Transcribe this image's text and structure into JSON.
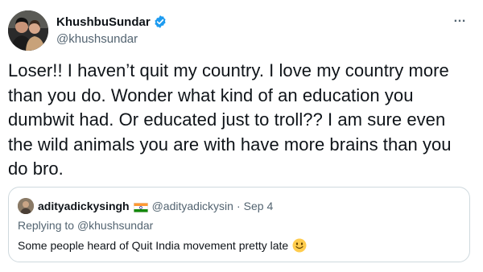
{
  "tweet": {
    "author": {
      "display_name": "KhushbuSundar",
      "handle": "@khushsundar",
      "verified": true,
      "avatar_icon": "profile-photo-two-people"
    },
    "more_label": "…",
    "text": "Loser!! I haven’t quit my country. I love my country more than you do. Wonder what kind of an education you dumbwit had. Or educated just to troll?? I am sure even the wild animals you are with have more brains than you do bro."
  },
  "quoted_tweet": {
    "author": {
      "display_name": "adityadickysingh",
      "flag_icon": "india-flag-icon",
      "handle": "@adityadickysin",
      "avatar_icon": "profile-photo-small"
    },
    "separator": "·",
    "date": "Sep 4",
    "replying_prefix": "Replying to ",
    "replying_to": "@khushsundar",
    "text": "Some people heard of Quit India movement pretty late",
    "emoji_icon": "slightly-smiling-face-emoji"
  },
  "colors": {
    "text_primary": "#0f1419",
    "text_secondary": "#536471",
    "verified_blue": "#1d9bf0",
    "border": "#cfd9de"
  }
}
